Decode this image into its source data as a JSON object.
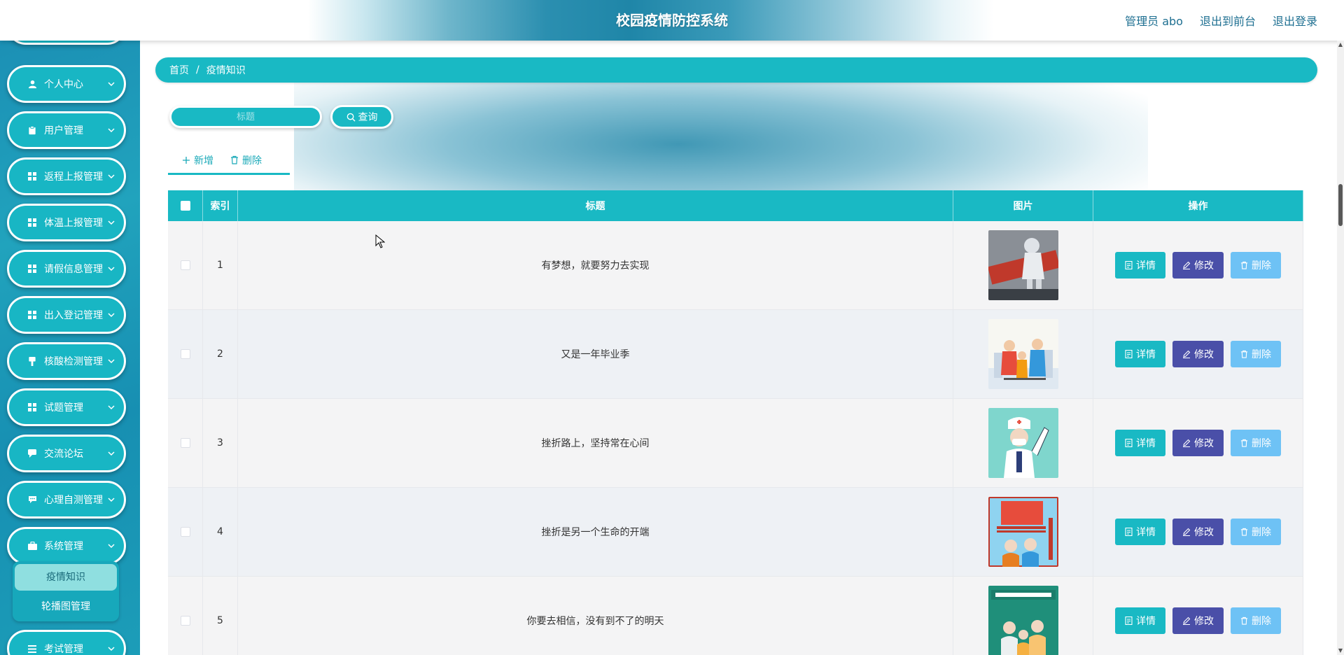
{
  "header": {
    "title": "校园疫情防控系统",
    "admin_label": "管理员 abo",
    "front_label": "退出到前台",
    "logout_label": "退出登录"
  },
  "sidebar": {
    "items": [
      {
        "label": "个人中心",
        "icon": "person-icon"
      },
      {
        "label": "用户管理",
        "icon": "clipboard-icon"
      },
      {
        "label": "返程上报管理",
        "icon": "grid-icon"
      },
      {
        "label": "体温上报管理",
        "icon": "grid-icon"
      },
      {
        "label": "请假信息管理",
        "icon": "grid-icon"
      },
      {
        "label": "出入登记管理",
        "icon": "grid-icon"
      },
      {
        "label": "核酸检测管理",
        "icon": "brush-icon"
      },
      {
        "label": "试题管理",
        "icon": "grid-icon"
      },
      {
        "label": "交流论坛",
        "icon": "chat-icon"
      },
      {
        "label": "心理自测管理",
        "icon": "comment-icon"
      },
      {
        "label": "系统管理",
        "icon": "briefcase-icon"
      },
      {
        "label": "考试管理",
        "icon": "list-icon"
      }
    ],
    "submenu": [
      {
        "label": "疫情知识",
        "active": true
      },
      {
        "label": "轮播图管理",
        "active": false
      }
    ]
  },
  "breadcrumb": {
    "home": "首页",
    "separator": "/",
    "current": "疫情知识"
  },
  "search": {
    "placeholder": "标题",
    "button_label": "查询"
  },
  "toolbar": {
    "add_label": "新增",
    "delete_label": "删除"
  },
  "table": {
    "columns": [
      "索引",
      "标题",
      "图片",
      "操作"
    ],
    "rows": [
      {
        "index": "1",
        "title": "有梦想，就要努力去实现"
      },
      {
        "index": "2",
        "title": "又是一年毕业季"
      },
      {
        "index": "3",
        "title": "挫折路上，坚持常在心间"
      },
      {
        "index": "4",
        "title": "挫折是另一个生命的开端"
      },
      {
        "index": "5",
        "title": "你要去相信，没有到不了的明天"
      }
    ],
    "actions": {
      "detail": "详情",
      "edit": "修改",
      "delete": "删除"
    }
  },
  "colors": {
    "primary": "#19b9c4",
    "edit": "#4a4fa8",
    "delete": "#6ec2f5"
  }
}
